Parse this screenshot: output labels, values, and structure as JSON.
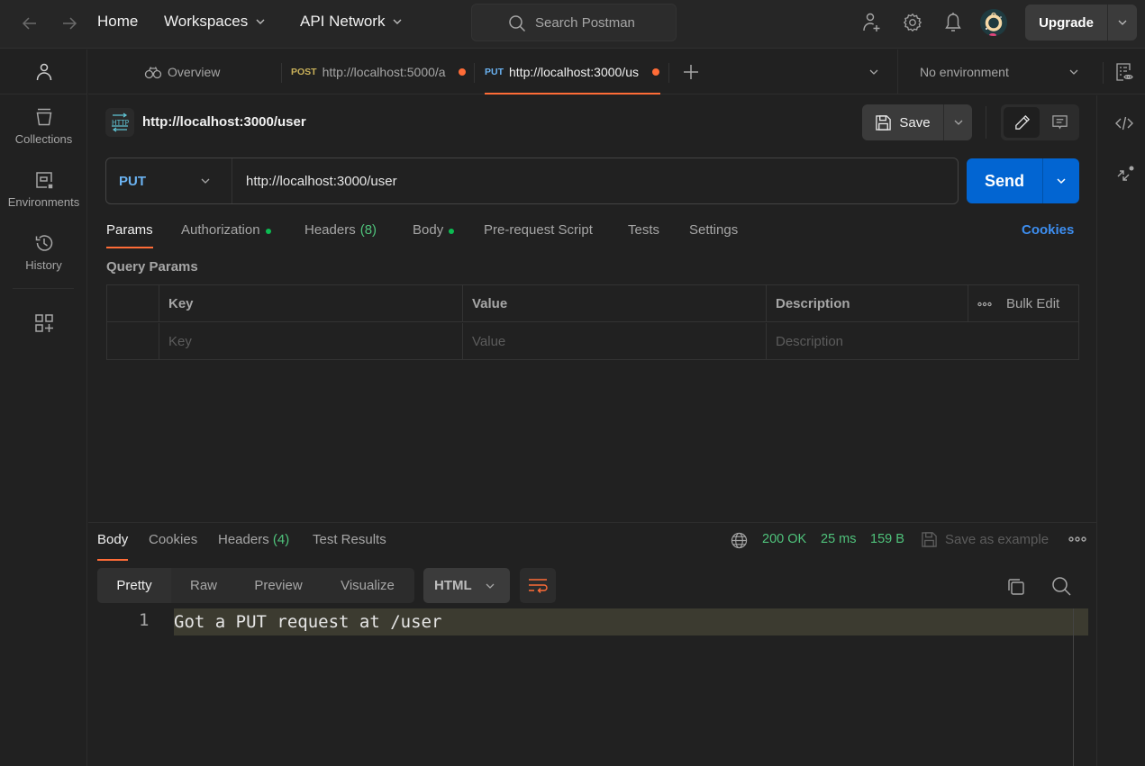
{
  "topbar": {
    "nav_links": [
      {
        "label": "Home",
        "has_dropdown": false
      },
      {
        "label": "Workspaces",
        "has_dropdown": true
      },
      {
        "label": "API Network",
        "has_dropdown": true
      }
    ],
    "search_placeholder": "Search Postman",
    "icons": [
      "invite-user-icon",
      "settings-icon",
      "notifications-icon"
    ],
    "upgrade_label": "Upgrade"
  },
  "sidebar": {
    "items": [
      {
        "label": "Collections",
        "icon": "collections-icon"
      },
      {
        "label": "Environments",
        "icon": "environments-icon"
      },
      {
        "label": "History",
        "icon": "history-icon"
      }
    ]
  },
  "tabs": {
    "items": [
      {
        "label": "Overview",
        "method": "",
        "icon": "overview-icon",
        "unsaved": false,
        "active": false
      },
      {
        "label": "http://localhost:5000/a",
        "method": "POST",
        "unsaved": true,
        "active": false
      },
      {
        "label": "http://localhost:3000/us",
        "method": "PUT",
        "unsaved": true,
        "active": true
      }
    ],
    "environment": "No environment"
  },
  "colors": {
    "accent_orange": "#ff6c37",
    "send_blue": "#0265d2",
    "put_method": "#6bb3f2",
    "post_method": "#c9b15a",
    "success_green": "#4fc27b",
    "dot_green": "#0cbb52",
    "link_blue": "#3d8ef0"
  },
  "request": {
    "title": "http://localhost:3000/user",
    "save_label": "Save",
    "method": "PUT",
    "url": "http://localhost:3000/user",
    "send_label": "Send",
    "tabs": [
      {
        "label": "Params",
        "active": true
      },
      {
        "label": "Authorization",
        "dot": true
      },
      {
        "label": "Headers",
        "count": "(8)"
      },
      {
        "label": "Body",
        "dot": true
      },
      {
        "label": "Pre-request Script"
      },
      {
        "label": "Tests"
      },
      {
        "label": "Settings"
      }
    ],
    "cookies_label": "Cookies",
    "query_params_title": "Query Params",
    "params_table": {
      "headers": [
        "Key",
        "Value",
        "Description"
      ],
      "bulk_edit_label": "Bulk Edit",
      "placeholders": {
        "key": "Key",
        "value": "Value",
        "description": "Description"
      }
    }
  },
  "response": {
    "tabs": [
      {
        "label": "Body",
        "active": true
      },
      {
        "label": "Cookies"
      },
      {
        "label": "Headers",
        "count": "(4)"
      },
      {
        "label": "Test Results"
      }
    ],
    "status": "200 OK",
    "time": "25 ms",
    "size": "159 B",
    "save_example_label": "Save as example",
    "view_modes": [
      "Pretty",
      "Raw",
      "Preview",
      "Visualize"
    ],
    "active_view": "Pretty",
    "format": "HTML",
    "lines": [
      {
        "number": "1",
        "text": "Got a PUT request at /user"
      }
    ]
  }
}
